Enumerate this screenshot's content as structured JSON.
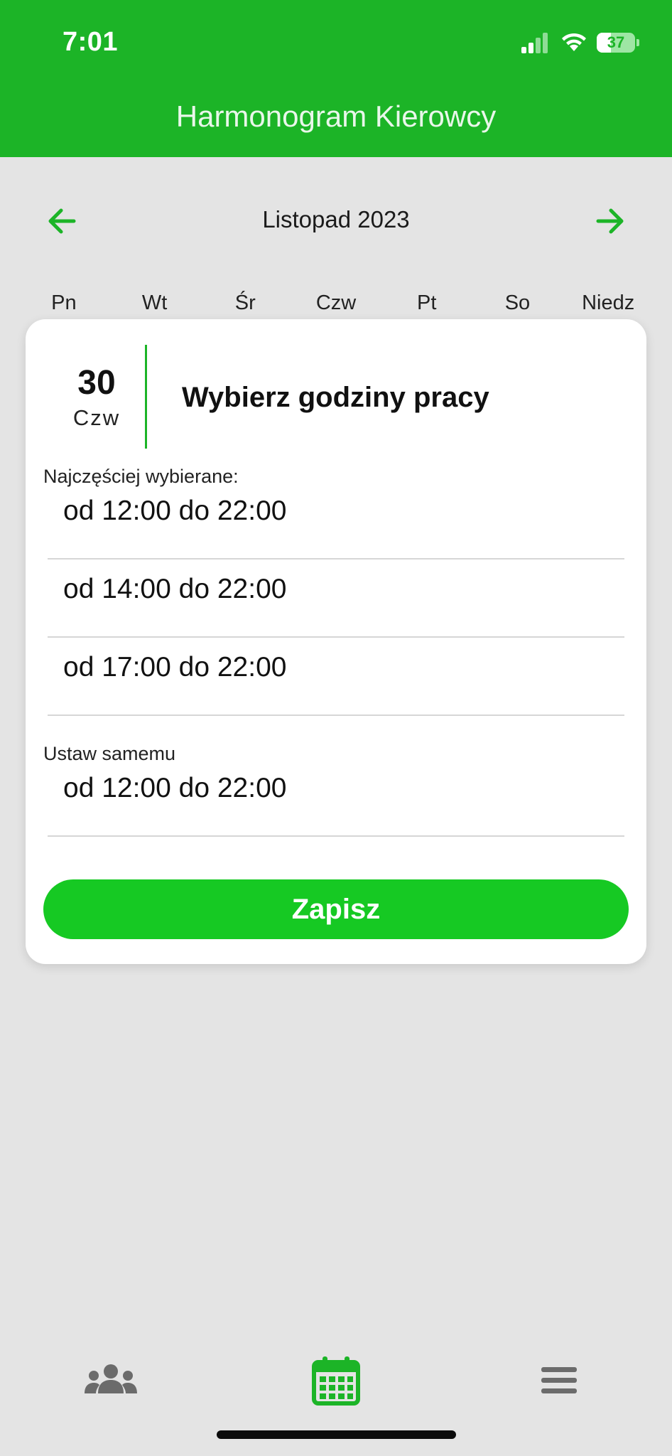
{
  "status_bar": {
    "time": "7:01",
    "battery": "37",
    "battery_fraction": 0.37
  },
  "header": {
    "title": "Harmonogram Kierowcy"
  },
  "colors": {
    "brand_green": "#1cb427",
    "button_green": "#16c923",
    "background": "#e4e4e4"
  },
  "month_nav": {
    "label": "Listopad 2023",
    "prev_icon": "arrow-left-icon",
    "next_icon": "arrow-right-icon"
  },
  "weekdays": [
    "Pn",
    "Wt",
    "Śr",
    "Czw",
    "Pt",
    "So",
    "Niedz"
  ],
  "dialog": {
    "day_number": "30",
    "day_name": "Czw",
    "title": "Wybierz godziny pracy",
    "frequent_label": "Najczęściej wybierane:",
    "options": [
      "od 12:00 do 22:00",
      "od 14:00 do 22:00",
      "od 17:00 do 22:00"
    ],
    "custom_label": "Ustaw samemu",
    "custom_value": "od 12:00 do 22:00",
    "save_label": "Zapisz"
  },
  "tabbar": {
    "items": [
      {
        "icon": "people-icon",
        "active": false
      },
      {
        "icon": "calendar-icon",
        "active": true
      },
      {
        "icon": "menu-icon",
        "active": false
      }
    ]
  }
}
